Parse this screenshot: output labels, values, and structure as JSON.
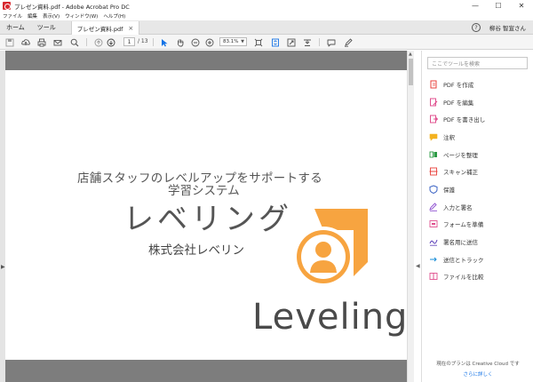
{
  "window": {
    "title": "プレゼン資料.pdf - Adobe Acrobat Pro DC",
    "minimize": "—",
    "maximize": "☐",
    "close": "✕"
  },
  "menu": [
    "ファイル",
    "編集",
    "表示(V)",
    "ウィンドウ(W)",
    "ヘルプ(H)"
  ],
  "tabs": {
    "home": "ホーム",
    "tools": "ツール",
    "document": "プレゼン資料.pdf",
    "close": "×"
  },
  "user": {
    "help": "?",
    "name": "柳谷 智宣さん"
  },
  "toolbar": {
    "page_current": "1",
    "page_total": "/ 13",
    "zoom": "83.1%"
  },
  "document": {
    "line1": "店舗スタッフのレベルアップをサポートする",
    "line2": "学習システム",
    "headline": "レベリング",
    "company": "株式会社レベリン",
    "brand": "Leveling",
    "logo_color": "#f7a440"
  },
  "tools_pane": {
    "search_placeholder": "ここでツールを検索",
    "items": [
      {
        "label": "PDF を作成",
        "icon": "create-pdf-icon",
        "color": "#e8413b"
      },
      {
        "label": "PDF を編集",
        "icon": "edit-pdf-icon",
        "color": "#e04f8e"
      },
      {
        "label": "PDF を書き出し",
        "icon": "export-pdf-icon",
        "color": "#e04f8e"
      },
      {
        "label": "注釈",
        "icon": "comment-icon",
        "color": "#f3b221"
      },
      {
        "label": "ページを整理",
        "icon": "organize-pages-icon",
        "color": "#2c9b45"
      },
      {
        "label": "スキャン補正",
        "icon": "enhance-scan-icon",
        "color": "#e8413b"
      },
      {
        "label": "保護",
        "icon": "protect-icon",
        "color": "#3b63c4"
      },
      {
        "label": "入力と署名",
        "icon": "fill-sign-icon",
        "color": "#8b4ccf"
      },
      {
        "label": "フォームを準備",
        "icon": "prepare-form-icon",
        "color": "#e04f8e"
      },
      {
        "label": "署名用に送信",
        "icon": "send-signature-icon",
        "color": "#5b3fb8"
      },
      {
        "label": "送信とトラック",
        "icon": "send-track-icon",
        "color": "#1a8fd8"
      },
      {
        "label": "ファイルを比較",
        "icon": "compare-files-icon",
        "color": "#e04f8e"
      }
    ],
    "plan_text": "現在のプランは Creative Cloud です",
    "plan_link": "さらに詳しく"
  }
}
